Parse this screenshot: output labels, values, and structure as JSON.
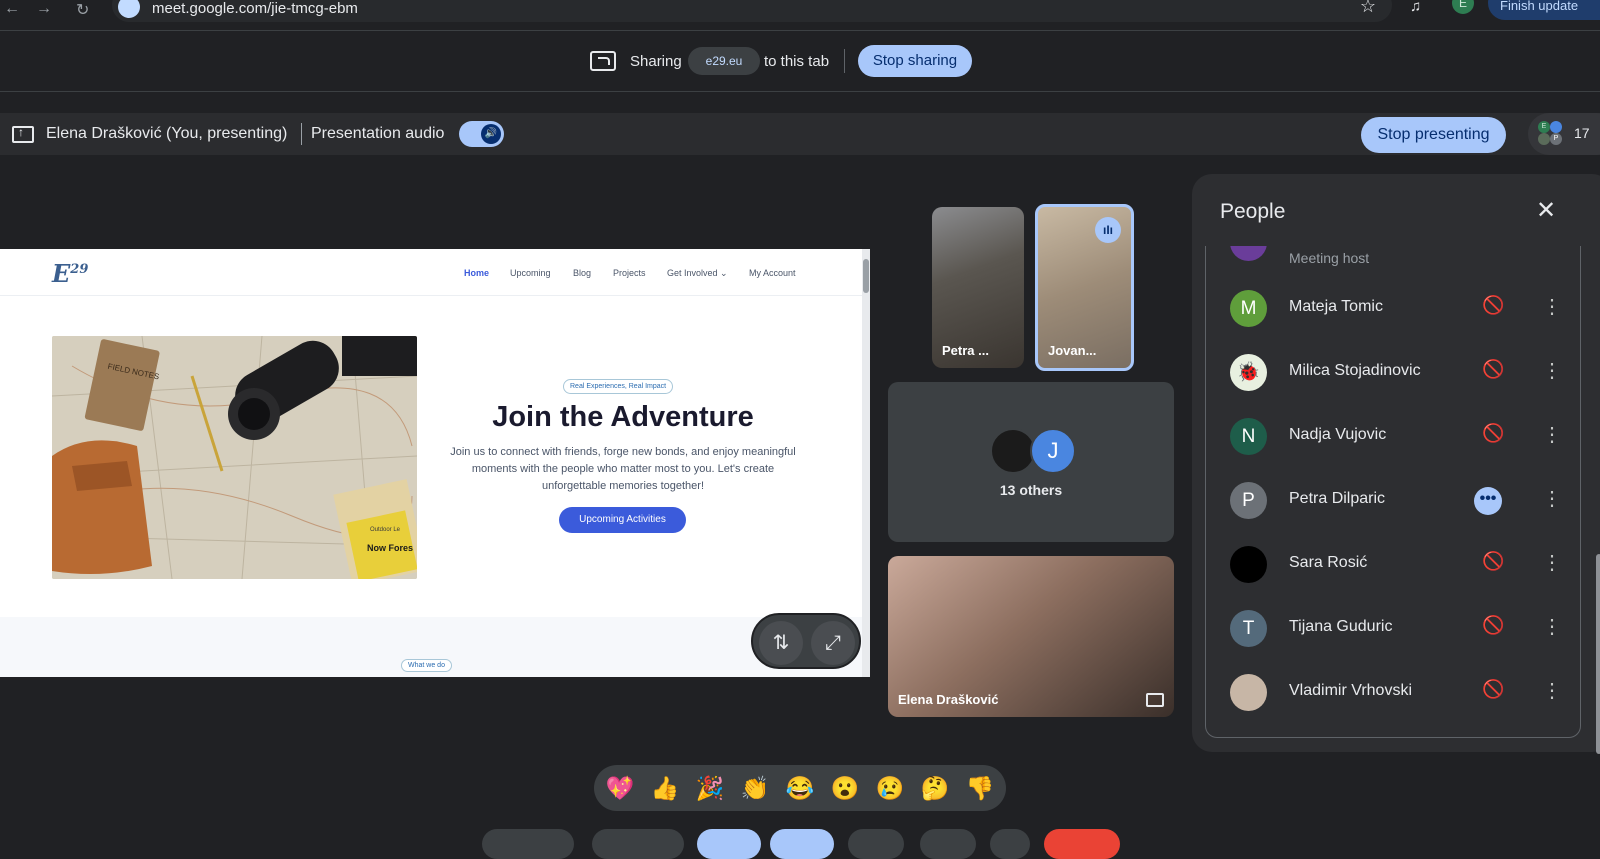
{
  "browser": {
    "url": "meet.google.com/jie-tmcg-ebm",
    "profile_initial": "E",
    "finish_update_label": "Finish update"
  },
  "sharing_bar": {
    "sharing_label": "Sharing",
    "domain": "e29.eu",
    "to_tab_label": "to this tab",
    "stop_sharing_label": "Stop sharing"
  },
  "presenting_bar": {
    "presenter": "Elena Drašković (You, presenting)",
    "audio_label": "Presentation audio",
    "audio_on": true,
    "stop_presenting_label": "Stop presenting",
    "participants_count": "17",
    "mini_avatars": [
      "E",
      "P"
    ]
  },
  "shared_site": {
    "logo": "E",
    "logo_sup": "29",
    "nav": [
      "Home",
      "Upcoming",
      "Blog",
      "Projects",
      "Get Involved ⌄",
      "My Account"
    ],
    "badge": "Real Experiences, Real Impact",
    "title": "Join the Adventure",
    "description": "Join us to connect with friends, forge new bonds, and enjoy meaningful moments with the people who matter most to you. Let's create unforgettable memories together!",
    "cta": "Upcoming Activities",
    "section_badge": "What we do",
    "photo_notebook": "FIELD NOTES",
    "photo_book1": "Now Fores",
    "photo_book2": "Outdoor Le"
  },
  "tiles": {
    "petra": "Petra ...",
    "jovan": "Jovan...",
    "others": "13 others",
    "others_initial": "J",
    "self": "Elena Drašković"
  },
  "people_panel": {
    "title": "People",
    "host_label": "Meeting host",
    "people": [
      {
        "name": "Mateja Tomic",
        "initial": "M",
        "color": "#5f9e3b",
        "status": "muted"
      },
      {
        "name": "Milica Stojadinovic",
        "initial": "🐞",
        "color": "#e8f0e0",
        "status": "muted"
      },
      {
        "name": "Nadja Vujovic",
        "initial": "N",
        "color": "#1e5d4a",
        "status": "muted"
      },
      {
        "name": "Petra Dilparic",
        "initial": "P",
        "color": "#6c7177",
        "status": "speaking"
      },
      {
        "name": "Sara Rosić",
        "initial": "",
        "color": "#000000",
        "status": "muted"
      },
      {
        "name": "Tijana Guduric",
        "initial": "T",
        "color": "#546a7b",
        "status": "muted"
      },
      {
        "name": "Vladimir Vrhovski",
        "initial": "",
        "color": "#c7b6a6",
        "status": "muted"
      }
    ]
  },
  "reactions": [
    "💖",
    "👍",
    "🎉",
    "👏",
    "😂",
    "😮",
    "😢",
    "🤔",
    "👎"
  ],
  "icons": {
    "mic_off": "🎙",
    "more": "⋮",
    "close": "✕",
    "star": "☆",
    "dots": "•••"
  }
}
